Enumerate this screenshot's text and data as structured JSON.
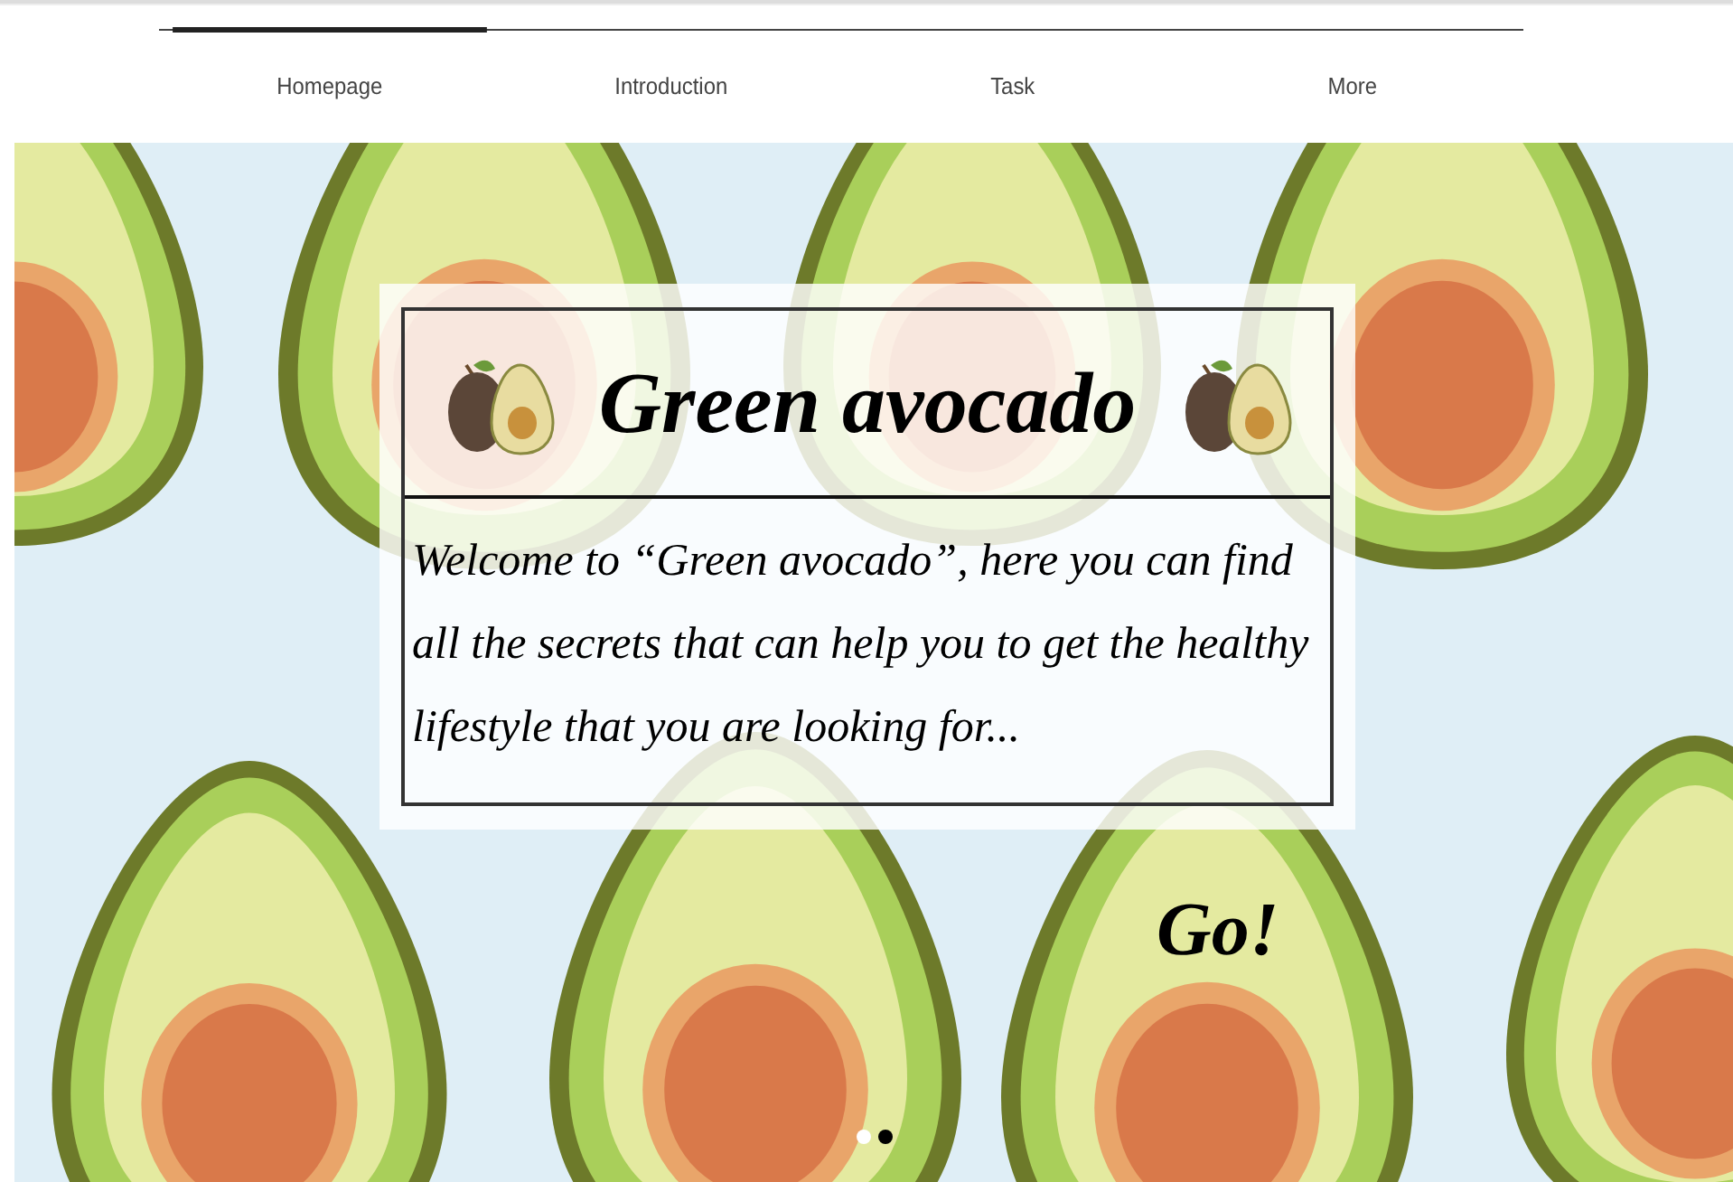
{
  "nav": {
    "tabs": [
      {
        "label": "Homepage",
        "selected": true
      },
      {
        "label": "Introduction",
        "selected": false
      },
      {
        "label": "Task",
        "selected": false
      },
      {
        "label": "More",
        "selected": false
      }
    ]
  },
  "hero": {
    "title": "Green avocado",
    "welcome": "Welcome to “Green avocado”, here you can find all the secrets that can help you to get the healthy lifestyle that you are looking for...",
    "go_button": "Go!",
    "slides": [
      {
        "selected": false
      },
      {
        "selected": true
      }
    ]
  }
}
